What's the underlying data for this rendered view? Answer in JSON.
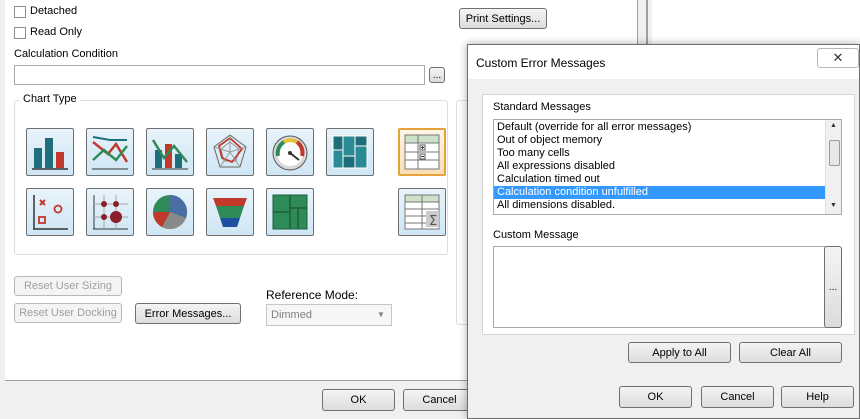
{
  "background_dialog": {
    "detached_label": "Detached",
    "read_only_label": "Read Only",
    "print_settings_label": "Print Settings...",
    "calculation_condition_label": "Calculation Condition",
    "calculation_condition_value": "",
    "ellipsis_label": "...",
    "chart_type_label": "Chart Type",
    "chart_types": [
      "bar-chart-icon",
      "line-chart-icon",
      "combo-chart-icon",
      "radar-chart-icon",
      "gauge-chart-icon",
      "mekko-chart-icon",
      "pivot-table-icon",
      "scatter-chart-icon",
      "grid-chart-icon",
      "pie-chart-icon",
      "funnel-chart-icon",
      "block-chart-icon",
      "straight-table-icon"
    ],
    "reset_user_sizing_label": "Reset User Sizing",
    "reset_user_docking_label": "Reset User Docking",
    "error_messages_label": "Error Messages...",
    "reference_mode_label": "Reference Mode:",
    "reference_mode_value": "Dimmed",
    "ok_label": "OK",
    "cancel_label": "Cancel"
  },
  "dialog": {
    "title": "Custom Error Messages",
    "close_glyph": "✕",
    "standard_messages_label": "Standard Messages",
    "standard_messages": [
      "Default (override for all error messages)",
      "Out of object memory",
      "Too many cells",
      "All expressions disabled",
      "Calculation timed out",
      "Calculation condition unfulfilled",
      "All dimensions disabled."
    ],
    "selected_index": 5,
    "custom_message_label": "Custom Message",
    "custom_message_value": "",
    "ellipsis_label": "...",
    "apply_to_all_label": "Apply to All",
    "clear_all_label": "Clear All",
    "ok_label": "OK",
    "cancel_label": "Cancel",
    "help_label": "Help"
  },
  "colors": {
    "selection": "#3399ff",
    "selected_chart_border": "#e5a13a"
  }
}
